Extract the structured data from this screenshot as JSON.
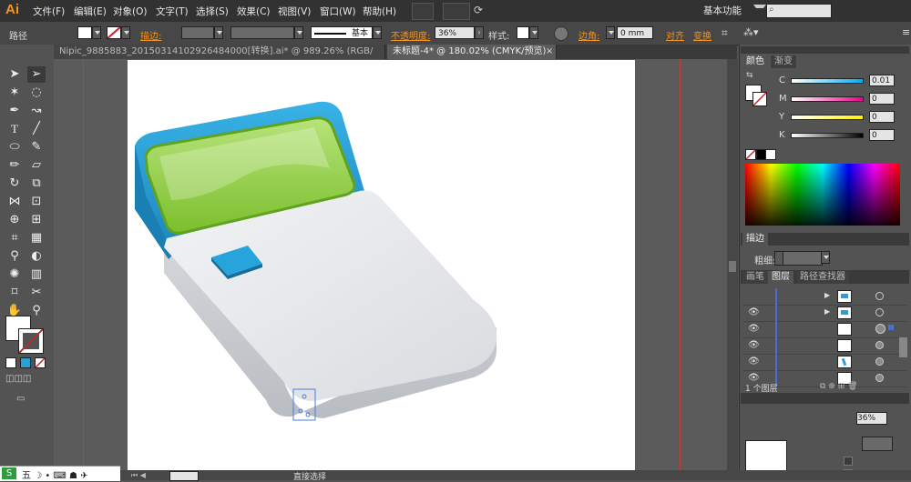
{
  "app": {
    "logo": "Ai"
  },
  "menu": [
    "文件(F)",
    "编辑(E)",
    "对象(O)",
    "文字(T)",
    "选择(S)",
    "效果(C)",
    "视图(V)",
    "窗口(W)",
    "帮助(H)"
  ],
  "workspace": "基本功能",
  "control": {
    "path_label": "路径",
    "stroke_label": "描边:",
    "stroke_profile": "基本",
    "opacity_label": "不透明度:",
    "opacity_value": "36%",
    "style_label": "样式:",
    "corner_label": "边角:",
    "corner_value": "0 mm",
    "align_label": "对齐",
    "transform_label": "变换"
  },
  "tabs": [
    {
      "label": "Nipic_9885883_20150314102926484000[转换].ai* @ 989.26% (RGB/预览)"
    },
    {
      "label": "未标题-4* @ 180.02% (CMYK/预览)"
    }
  ],
  "color_panel": {
    "tabs": [
      "颜色",
      "渐变"
    ],
    "channels": [
      {
        "name": "C",
        "value": "0.01"
      },
      {
        "name": "M",
        "value": "0"
      },
      {
        "name": "Y",
        "value": "0"
      },
      {
        "name": "K",
        "value": "0"
      }
    ]
  },
  "stroke_panel": {
    "title": "描边",
    "weight_label": "粗细:"
  },
  "layers_panel": {
    "tabs": [
      "画笔",
      "图层",
      "路径查找器"
    ],
    "count_label": "1 个图层"
  },
  "status": {
    "tool_label": "直接选择"
  },
  "colors": {
    "accent": "#f7931e",
    "blue": "#2c9fd6",
    "green": "#8cc63f"
  }
}
